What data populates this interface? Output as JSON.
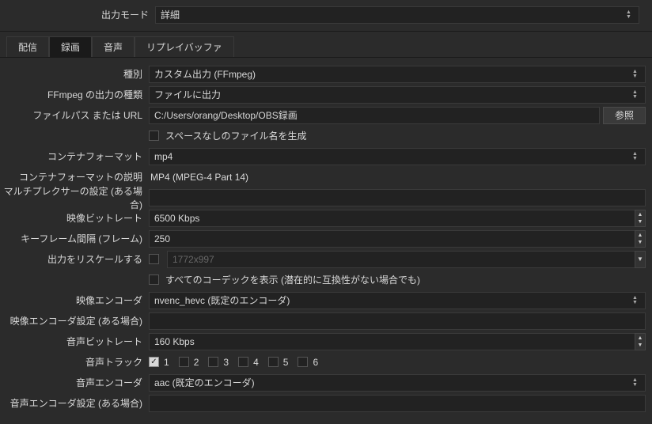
{
  "output_mode": {
    "label": "出力モード",
    "value": "詳細"
  },
  "tabs": {
    "stream": "配信",
    "record": "録画",
    "audio": "音声",
    "replay": "リプレイバッファ"
  },
  "type": {
    "label": "種別",
    "value": "カスタム出力 (FFmpeg)"
  },
  "ffmpeg_output_type": {
    "label": "FFmpeg の出力の種類",
    "value": "ファイルに出力"
  },
  "filepath": {
    "label": "ファイルパス または URL",
    "value": "C:/Users/orang/Desktop/OBS録画",
    "browse": "参照"
  },
  "no_space": {
    "label": "スペースなしのファイル名を生成"
  },
  "container": {
    "label": "コンテナフォーマット",
    "value": "mp4"
  },
  "container_desc": {
    "label": "コンテナフォーマットの説明",
    "value": "MP4 (MPEG-4 Part 14)"
  },
  "mux": {
    "label": "マルチプレクサーの設定 (ある場合)",
    "value": ""
  },
  "vbitrate": {
    "label": "映像ビットレート",
    "value": "6500 Kbps"
  },
  "keyframe": {
    "label": "キーフレーム間隔 (フレーム)",
    "value": "250"
  },
  "rescale": {
    "label": "出力をリスケールする",
    "placeholder": "1772x997"
  },
  "show_all": {
    "label": "すべてのコーデックを表示 (潜在的に互換性がない場合でも)"
  },
  "venc": {
    "label": "映像エンコーダ",
    "value": "nvenc_hevc (既定のエンコーダ)"
  },
  "venc_set": {
    "label": "映像エンコーダ設定 (ある場合)",
    "value": ""
  },
  "abitrate": {
    "label": "音声ビットレート",
    "value": "160 Kbps"
  },
  "atrack": {
    "label": "音声トラック",
    "tracks": [
      "1",
      "2",
      "3",
      "4",
      "5",
      "6"
    ]
  },
  "aenc": {
    "label": "音声エンコーダ",
    "value": "aac (既定のエンコーダ)"
  },
  "aenc_set": {
    "label": "音声エンコーダ設定 (ある場合)",
    "value": ""
  }
}
